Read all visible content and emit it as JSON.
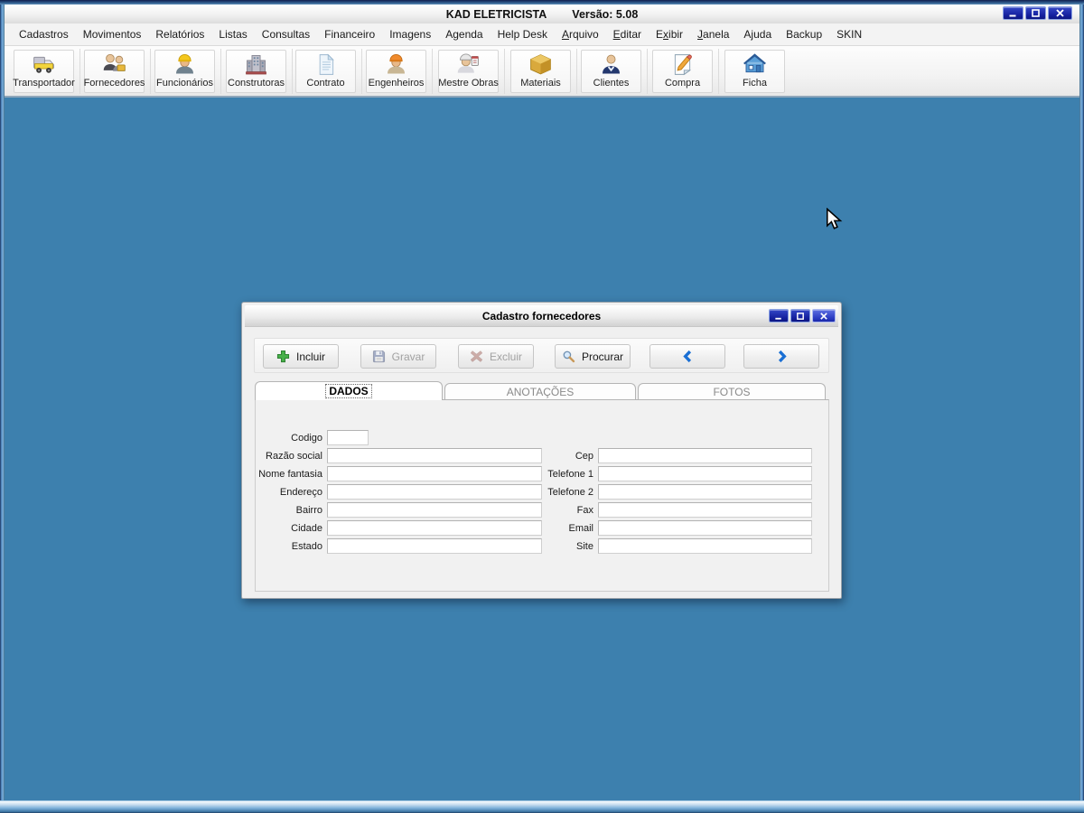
{
  "window": {
    "title": "KAD ELETRICISTA",
    "version_label": "Versão: 5.08"
  },
  "menu": {
    "items": [
      {
        "label": "Cadastros"
      },
      {
        "label": "Movimentos"
      },
      {
        "label": "Relatórios"
      },
      {
        "label": "Listas"
      },
      {
        "label": "Consultas"
      },
      {
        "label": "Financeiro"
      },
      {
        "label": "Imagens"
      },
      {
        "label": "Agenda"
      },
      {
        "label": "Help Desk"
      },
      {
        "label": "Arquivo",
        "underline": 0
      },
      {
        "label": "Editar",
        "underline": 0
      },
      {
        "label": "Exibir",
        "underline": 1
      },
      {
        "label": "Janela",
        "underline": 0
      },
      {
        "label": "Ajuda"
      },
      {
        "label": "Backup"
      },
      {
        "label": "SKIN"
      }
    ]
  },
  "toolbar": {
    "buttons": [
      {
        "label": "Transportador",
        "icon": "truck-icon"
      },
      {
        "label": "Fornecedores",
        "icon": "suppliers-icon"
      },
      {
        "label": "Funcionários",
        "icon": "worker-icon"
      },
      {
        "label": "Construtoras",
        "icon": "building-icon"
      },
      {
        "label": "Contrato",
        "icon": "document-icon"
      },
      {
        "label": "Engenheiros",
        "icon": "engineer-icon"
      },
      {
        "label": "Mestre Obras",
        "icon": "foreman-icon"
      },
      {
        "label": "Materiais",
        "icon": "box-icon"
      },
      {
        "label": "Clientes",
        "icon": "client-icon"
      },
      {
        "label": "Compra",
        "icon": "purchase-icon"
      },
      {
        "label": "Ficha",
        "icon": "house-icon"
      }
    ]
  },
  "child_window": {
    "title": "Cadastro fornecedores",
    "actions": [
      {
        "label": "Incluir",
        "icon": "plus-icon",
        "enabled": true
      },
      {
        "label": "Gravar",
        "icon": "save-icon",
        "enabled": false
      },
      {
        "label": "Excluir",
        "icon": "delete-icon",
        "enabled": false
      },
      {
        "label": "Procurar",
        "icon": "search-icon",
        "enabled": true
      },
      {
        "label": "",
        "icon": "chevron-left-icon",
        "enabled": true
      },
      {
        "label": "",
        "icon": "chevron-right-icon",
        "enabled": true
      }
    ],
    "tabs": [
      {
        "label": "DADOS",
        "active": true
      },
      {
        "label": "ANOTAÇÕES",
        "active": false
      },
      {
        "label": "FOTOS",
        "active": false
      }
    ],
    "form": {
      "left_fields": [
        {
          "label": "Codigo",
          "value": "",
          "size": "small"
        },
        {
          "label": "Razão social",
          "value": ""
        },
        {
          "label": "Nome fantasia",
          "value": ""
        },
        {
          "label": "Endereço",
          "value": ""
        },
        {
          "label": "Bairro",
          "value": ""
        },
        {
          "label": "Cidade",
          "value": ""
        },
        {
          "label": "Estado",
          "value": ""
        }
      ],
      "right_fields": [
        {
          "label": "Cep",
          "value": ""
        },
        {
          "label": "Telefone 1",
          "value": ""
        },
        {
          "label": "Telefone 2",
          "value": ""
        },
        {
          "label": "Fax",
          "value": ""
        },
        {
          "label": "Email",
          "value": ""
        },
        {
          "label": "Site",
          "value": ""
        }
      ]
    }
  },
  "colors": {
    "desktop_blue": "#3d80ae",
    "control_button_blue": "#14209e",
    "frame_blue": "#5b93c8",
    "accent_green": "#47b04a",
    "accent_red": "#d84a38",
    "arrow_blue": "#1a6fd4"
  }
}
